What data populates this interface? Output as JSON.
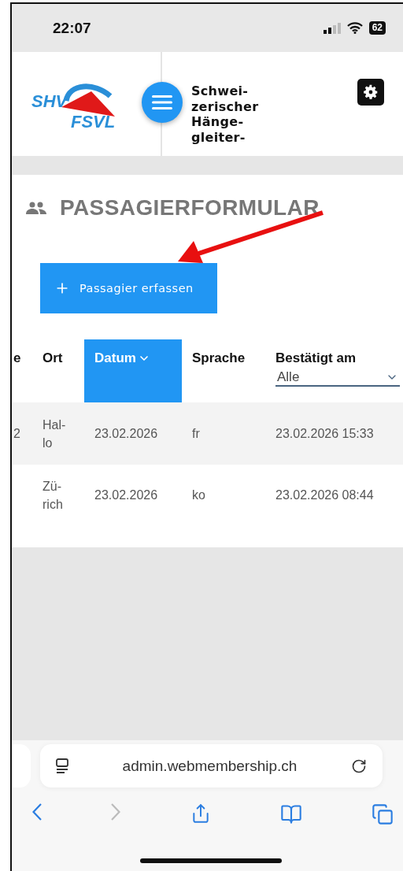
{
  "status_bar": {
    "time": "22:07",
    "battery": "62"
  },
  "header": {
    "logo": {
      "top": "SHV",
      "bottom": "FSVL"
    },
    "title_lines": [
      "Schwei-",
      "zerischer",
      "Hänge-",
      "gleiter-"
    ]
  },
  "page": {
    "title": "PASSAGIERFORMULAR",
    "add_button": "Passagier erfassen"
  },
  "table": {
    "columns": [
      {
        "label": "e",
        "sorted": false
      },
      {
        "label": "Ort",
        "sorted": false
      },
      {
        "label": "Datum",
        "sorted": true
      },
      {
        "label": "Sprache",
        "sorted": false
      },
      {
        "label": "Bestätigt am",
        "sorted": false,
        "filter": "Alle"
      }
    ],
    "rows": [
      {
        "column_1": "2",
        "ort": "Hal-lo",
        "datum": "23.02.2026",
        "sprache": "fr",
        "bestaetigt_am": "23.02.2026 15:33"
      },
      {
        "ort": "Zü-rich",
        "datum": "23.02.2026",
        "sprache": "ko",
        "bestaetigt_am": "23.02.2026 08:44"
      }
    ]
  },
  "browser": {
    "url": "admin.webmembership.ch"
  }
}
